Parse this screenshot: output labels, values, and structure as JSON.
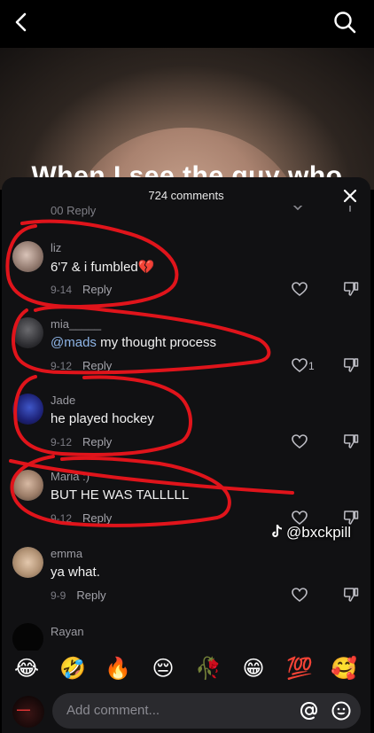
{
  "video": {
    "caption": "When I see the guy who"
  },
  "comments_header": {
    "count_label": "724 comments"
  },
  "peek_row": {
    "text": "00   Reply"
  },
  "comments": [
    {
      "username": "liz",
      "text": "6'7 & i fumbled",
      "text_emoji": "💔",
      "date": "9-14",
      "reply_label": "Reply",
      "likes": ""
    },
    {
      "username": "mia_____",
      "mention": "@mads",
      "text": " my thought process",
      "date": "9-12",
      "reply_label": "Reply",
      "likes": "1"
    },
    {
      "username": "Jade",
      "text": "he played hockey",
      "date": "9-12",
      "reply_label": "Reply",
      "likes": ""
    },
    {
      "username": "Maria :)",
      "text": "BUT HE WAS TALLLLL",
      "date": "9-12",
      "reply_label": "Reply",
      "likes": ""
    },
    {
      "username": "emma",
      "text": "ya what.",
      "date": "9-9",
      "reply_label": "Reply",
      "likes": ""
    },
    {
      "username": "Rayan",
      "text": "",
      "date": "",
      "reply_label": "",
      "likes": ""
    }
  ],
  "emoji_bar": [
    "😂",
    "🤣",
    "🔥",
    "😔",
    "🥀",
    "😁",
    "💯",
    "🥰"
  ],
  "input": {
    "placeholder": "Add comment..."
  },
  "watermark": {
    "handle": "@bxckpill"
  },
  "colors": {
    "scribble": "#e0141b",
    "sheet_bg": "#111113",
    "mention": "#8fb6e8"
  }
}
